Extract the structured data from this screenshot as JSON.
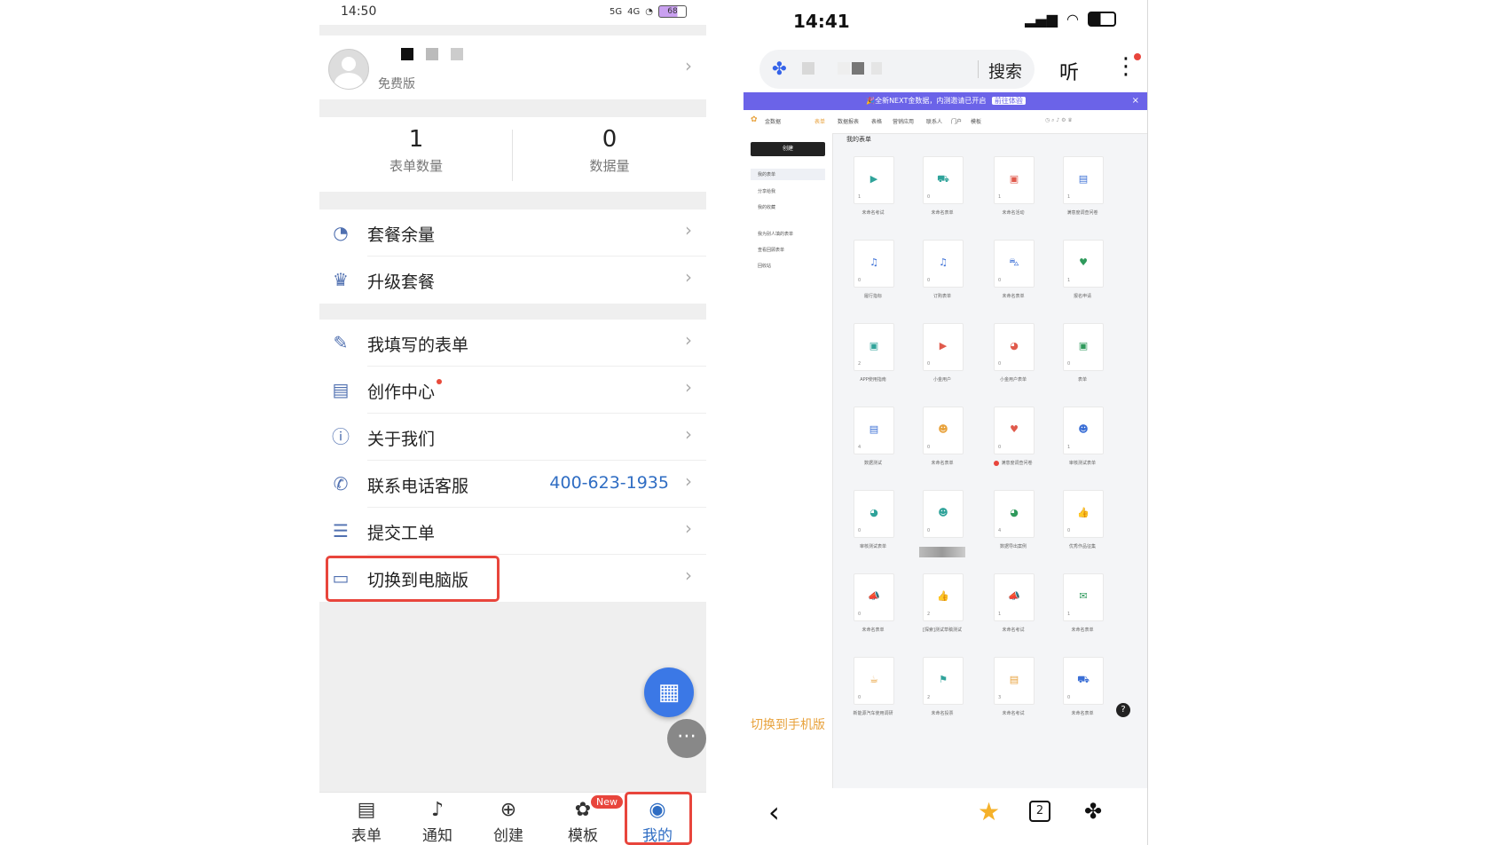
{
  "left_phone": {
    "status_time": "14:50",
    "status_net_1": "5G",
    "status_net_2": "4G",
    "battery": "68",
    "profile": {
      "plan": "免费版"
    },
    "stats": [
      {
        "value": "1",
        "label": "表单数量"
      },
      {
        "value": "0",
        "label": "数据量"
      }
    ],
    "menu_group_1": [
      {
        "icon": "pie-chart-icon",
        "label": "套餐余量"
      },
      {
        "icon": "crown-icon",
        "label": "升级套餐"
      }
    ],
    "menu_group_2": [
      {
        "icon": "form-edit-icon",
        "label": "我填写的表单"
      },
      {
        "icon": "creation-icon",
        "label": "创作中心"
      },
      {
        "icon": "info-icon",
        "label": "关于我们"
      },
      {
        "icon": "phone-icon",
        "label": "联系电话客服",
        "value": "400-623-1935"
      },
      {
        "icon": "ticket-icon",
        "label": "提交工单"
      },
      {
        "icon": "desktop-icon",
        "label": "切换到电脑版"
      }
    ],
    "tabs": [
      {
        "icon": "form-icon",
        "label": "表单"
      },
      {
        "icon": "bell-icon",
        "label": "通知"
      },
      {
        "icon": "plus-circle-icon",
        "label": "创建"
      },
      {
        "icon": "template-icon",
        "label": "模板"
      },
      {
        "icon": "user-icon",
        "label": "我的"
      }
    ],
    "new_badge": "New",
    "colors": {
      "accent": "#2f6dc3",
      "highlight": "#e8453c"
    }
  },
  "right_phone": {
    "status_time": "14:41",
    "search_label": "搜索",
    "listen_label": "听",
    "banner_text": "🎉全新NEXT金数据，内测邀请已开启",
    "banner_button": "前往体验",
    "desktop": {
      "brand": "金数据",
      "nav": [
        "表单",
        "数据报表",
        "表格",
        "营销应用",
        "联系人",
        "门户",
        "模板"
      ],
      "create": "创建",
      "sidebar": [
        "我的表单",
        "分享给我",
        "我的收藏",
        "我为别人填的表单",
        "查看回顾表单",
        "回收站"
      ],
      "section_title": "我的表单",
      "cards": [
        {
          "icon": "video-icon",
          "color": "#2fa39a",
          "count": "1",
          "name": "未命名考试"
        },
        {
          "icon": "cart-icon",
          "color": "#2fa39a",
          "count": "0",
          "name": "未命名表单"
        },
        {
          "icon": "briefcase-icon",
          "color": "#e05a4c",
          "count": "1",
          "name": "未命名活动"
        },
        {
          "icon": "book-icon",
          "color": "#3b6fd6",
          "count": "1",
          "name": "满意度调查问卷"
        },
        {
          "icon": "music-icon",
          "color": "#3b6fd6",
          "count": "0",
          "name": "履行指标"
        },
        {
          "icon": "music-icon",
          "color": "#3b6fd6",
          "count": "0",
          "name": "订购表单"
        },
        {
          "icon": "car-icon",
          "color": "#3b6fd6",
          "count": "0",
          "name": "未命名表单"
        },
        {
          "icon": "heart-icon",
          "color": "#2f9a5c",
          "count": "1",
          "name": "报名申请"
        },
        {
          "icon": "briefcase-icon",
          "color": "#2fa39a",
          "count": "2",
          "name": "APP使用指南"
        },
        {
          "icon": "video-icon",
          "color": "#e05a4c",
          "count": "0",
          "name": "小金用户"
        },
        {
          "icon": "pie-icon",
          "color": "#e05a4c",
          "count": "0",
          "name": "小金用户表单"
        },
        {
          "icon": "briefcase-icon",
          "color": "#2f9a5c",
          "count": "0",
          "name": "表单"
        },
        {
          "icon": "book-icon",
          "color": "#3b6fd6",
          "count": "4",
          "name": "数据测试"
        },
        {
          "icon": "person-icon",
          "color": "#e8a23c",
          "count": "0",
          "name": "未命名表单"
        },
        {
          "icon": "heart-icon",
          "color": "#e05a4c",
          "count": "0",
          "name": "满意度调查问卷"
        },
        {
          "icon": "person-icon",
          "color": "#3b6fd6",
          "count": "1",
          "name": "审核测试表单"
        },
        {
          "icon": "pie-icon",
          "color": "#2fa39a",
          "count": "0",
          "name": "审核测试表单"
        },
        {
          "icon": "person-icon",
          "color": "#2fa39a",
          "count": "0",
          "name": ""
        },
        {
          "icon": "pie-icon",
          "color": "#2f9a5c",
          "count": "4",
          "name": "数据导出案例"
        },
        {
          "icon": "thumb-icon",
          "color": "#3b6fd6",
          "count": "0",
          "name": "优秀作品征集"
        },
        {
          "icon": "megaphone-icon",
          "color": "#2fa39a",
          "count": "0",
          "name": "未命名表单"
        },
        {
          "icon": "thumb-icon",
          "color": "#2fa39a",
          "count": "2",
          "name": "[探索]测试草稿测试"
        },
        {
          "icon": "megaphone-icon",
          "color": "#e05a4c",
          "count": "1",
          "name": "未命名考试"
        },
        {
          "icon": "chat-icon",
          "color": "#2f9a5c",
          "count": "1",
          "name": "未命名表单"
        },
        {
          "icon": "cup-icon",
          "color": "#e8a23c",
          "count": "0",
          "name": "新能源汽车使用调研"
        },
        {
          "icon": "flag-icon",
          "color": "#2fa39a",
          "count": "2",
          "name": "未命名投票"
        },
        {
          "icon": "book-icon",
          "color": "#e8a23c",
          "count": "3",
          "name": "未命名考试"
        },
        {
          "icon": "cart-icon",
          "color": "#3b6fd6",
          "count": "0",
          "name": "未命名表单"
        }
      ],
      "switch_mobile": "切换到手机版",
      "help": "?"
    },
    "bottom": {
      "tabs_count": "2"
    }
  }
}
